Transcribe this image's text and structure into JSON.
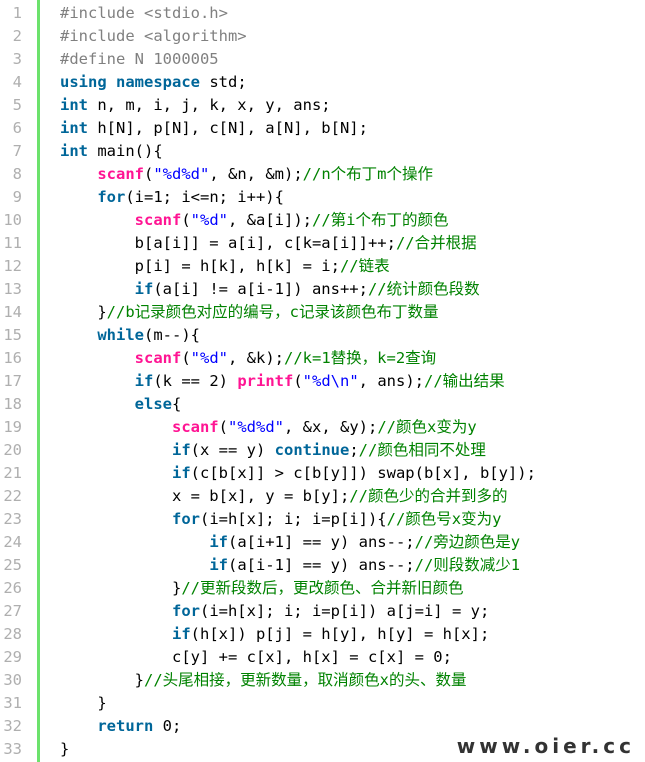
{
  "watermark": "www.oier.cc",
  "colors": {
    "gutter_bar": "#6ce26c",
    "keyword": "#006699",
    "function": "#ff1493",
    "string": "#0000ff",
    "comment": "#008200",
    "preprocessor": "#808080",
    "line_number": "#afafaf"
  },
  "lines": [
    {
      "n": "1",
      "tokens": [
        [
          "pre",
          "#include <stdio.h>"
        ]
      ]
    },
    {
      "n": "2",
      "tokens": [
        [
          "pre",
          "#include <algorithm>"
        ]
      ]
    },
    {
      "n": "3",
      "tokens": [
        [
          "pre",
          "#define N 1000005"
        ]
      ]
    },
    {
      "n": "4",
      "tokens": [
        [
          "kw",
          "using"
        ],
        [
          "plain",
          " "
        ],
        [
          "kw",
          "namespace"
        ],
        [
          "plain",
          " std;"
        ]
      ]
    },
    {
      "n": "5",
      "tokens": [
        [
          "type",
          "int"
        ],
        [
          "plain",
          " n, m, i, j, k, x, y, ans;"
        ]
      ]
    },
    {
      "n": "6",
      "tokens": [
        [
          "type",
          "int"
        ],
        [
          "plain",
          " h[N], p[N], c[N], a[N], b[N];"
        ]
      ]
    },
    {
      "n": "7",
      "tokens": [
        [
          "type",
          "int"
        ],
        [
          "plain",
          " main(){"
        ]
      ]
    },
    {
      "n": "8",
      "tokens": [
        [
          "plain",
          "    "
        ],
        [
          "fn",
          "scanf"
        ],
        [
          "plain",
          "("
        ],
        [
          "str",
          "\"%d%d\""
        ],
        [
          "plain",
          ", &n, &m);"
        ],
        [
          "cmt",
          "//n个布丁m个操作"
        ]
      ]
    },
    {
      "n": "9",
      "tokens": [
        [
          "plain",
          "    "
        ],
        [
          "kw",
          "for"
        ],
        [
          "plain",
          "(i=1; i<=n; i++){"
        ]
      ]
    },
    {
      "n": "10",
      "tokens": [
        [
          "plain",
          "        "
        ],
        [
          "fn",
          "scanf"
        ],
        [
          "plain",
          "("
        ],
        [
          "str",
          "\"%d\""
        ],
        [
          "plain",
          ", &a[i]);"
        ],
        [
          "cmt",
          "//第i个布丁的颜色"
        ]
      ]
    },
    {
      "n": "11",
      "tokens": [
        [
          "plain",
          "        b[a[i]] = a[i], c[k=a[i]]++;"
        ],
        [
          "cmt",
          "//合并根据"
        ]
      ]
    },
    {
      "n": "12",
      "tokens": [
        [
          "plain",
          "        p[i] = h[k], h[k] = i;"
        ],
        [
          "cmt",
          "//链表"
        ]
      ]
    },
    {
      "n": "13",
      "tokens": [
        [
          "plain",
          "        "
        ],
        [
          "kw",
          "if"
        ],
        [
          "plain",
          "(a[i] != a[i-1]) ans++;"
        ],
        [
          "cmt",
          "//统计颜色段数"
        ]
      ]
    },
    {
      "n": "14",
      "tokens": [
        [
          "plain",
          "    }"
        ],
        [
          "cmt",
          "//b记录颜色对应的编号，c记录该颜色布丁数量"
        ]
      ]
    },
    {
      "n": "15",
      "tokens": [
        [
          "plain",
          "    "
        ],
        [
          "kw",
          "while"
        ],
        [
          "plain",
          "(m--){"
        ]
      ]
    },
    {
      "n": "16",
      "tokens": [
        [
          "plain",
          "        "
        ],
        [
          "fn",
          "scanf"
        ],
        [
          "plain",
          "("
        ],
        [
          "str",
          "\"%d\""
        ],
        [
          "plain",
          ", &k);"
        ],
        [
          "cmt",
          "//k=1替换，k=2查询"
        ]
      ]
    },
    {
      "n": "17",
      "tokens": [
        [
          "plain",
          "        "
        ],
        [
          "kw",
          "if"
        ],
        [
          "plain",
          "(k == 2) "
        ],
        [
          "fn",
          "printf"
        ],
        [
          "plain",
          "("
        ],
        [
          "str",
          "\"%d\\n\""
        ],
        [
          "plain",
          ", ans);"
        ],
        [
          "cmt",
          "//输出结果"
        ]
      ]
    },
    {
      "n": "18",
      "tokens": [
        [
          "plain",
          "        "
        ],
        [
          "kw",
          "else"
        ],
        [
          "plain",
          "{"
        ]
      ]
    },
    {
      "n": "19",
      "tokens": [
        [
          "plain",
          "            "
        ],
        [
          "fn",
          "scanf"
        ],
        [
          "plain",
          "("
        ],
        [
          "str",
          "\"%d%d\""
        ],
        [
          "plain",
          ", &x, &y);"
        ],
        [
          "cmt",
          "//颜色x变为y"
        ]
      ]
    },
    {
      "n": "20",
      "tokens": [
        [
          "plain",
          "            "
        ],
        [
          "kw",
          "if"
        ],
        [
          "plain",
          "(x == y) "
        ],
        [
          "kw",
          "continue"
        ],
        [
          "plain",
          ";"
        ],
        [
          "cmt",
          "//颜色相同不处理"
        ]
      ]
    },
    {
      "n": "21",
      "tokens": [
        [
          "plain",
          "            "
        ],
        [
          "kw",
          "if"
        ],
        [
          "plain",
          "(c[b[x]] > c[b[y]]) swap(b[x], b[y]);"
        ]
      ]
    },
    {
      "n": "22",
      "tokens": [
        [
          "plain",
          "            x = b[x], y = b[y];"
        ],
        [
          "cmt",
          "//颜色少的合并到多的"
        ]
      ]
    },
    {
      "n": "23",
      "tokens": [
        [
          "plain",
          "            "
        ],
        [
          "kw",
          "for"
        ],
        [
          "plain",
          "(i=h[x]; i; i=p[i]){"
        ],
        [
          "cmt",
          "//颜色号x变为y"
        ]
      ]
    },
    {
      "n": "24",
      "tokens": [
        [
          "plain",
          "                "
        ],
        [
          "kw",
          "if"
        ],
        [
          "plain",
          "(a[i+1] == y) ans--;"
        ],
        [
          "cmt",
          "//旁边颜色是y"
        ]
      ]
    },
    {
      "n": "25",
      "tokens": [
        [
          "plain",
          "                "
        ],
        [
          "kw",
          "if"
        ],
        [
          "plain",
          "(a[i-1] == y) ans--;"
        ],
        [
          "cmt",
          "//则段数减少1"
        ]
      ]
    },
    {
      "n": "26",
      "tokens": [
        [
          "plain",
          "            }"
        ],
        [
          "cmt",
          "//更新段数后，更改颜色、合并新旧颜色"
        ]
      ]
    },
    {
      "n": "27",
      "tokens": [
        [
          "plain",
          "            "
        ],
        [
          "kw",
          "for"
        ],
        [
          "plain",
          "(i=h[x]; i; i=p[i]) a[j=i] = y;"
        ]
      ]
    },
    {
      "n": "28",
      "tokens": [
        [
          "plain",
          "            "
        ],
        [
          "kw",
          "if"
        ],
        [
          "plain",
          "(h[x]) p[j] = h[y], h[y] = h[x];"
        ]
      ]
    },
    {
      "n": "29",
      "tokens": [
        [
          "plain",
          "            c[y] += c[x], h[x] = c[x] = 0;"
        ]
      ]
    },
    {
      "n": "30",
      "tokens": [
        [
          "plain",
          "        }"
        ],
        [
          "cmt",
          "//头尾相接，更新数量，取消颜色x的头、数量"
        ]
      ]
    },
    {
      "n": "31",
      "tokens": [
        [
          "plain",
          "    }"
        ]
      ]
    },
    {
      "n": "32",
      "tokens": [
        [
          "plain",
          "    "
        ],
        [
          "kw",
          "return"
        ],
        [
          "plain",
          " 0;"
        ]
      ]
    },
    {
      "n": "33",
      "tokens": [
        [
          "plain",
          "}"
        ]
      ]
    }
  ]
}
